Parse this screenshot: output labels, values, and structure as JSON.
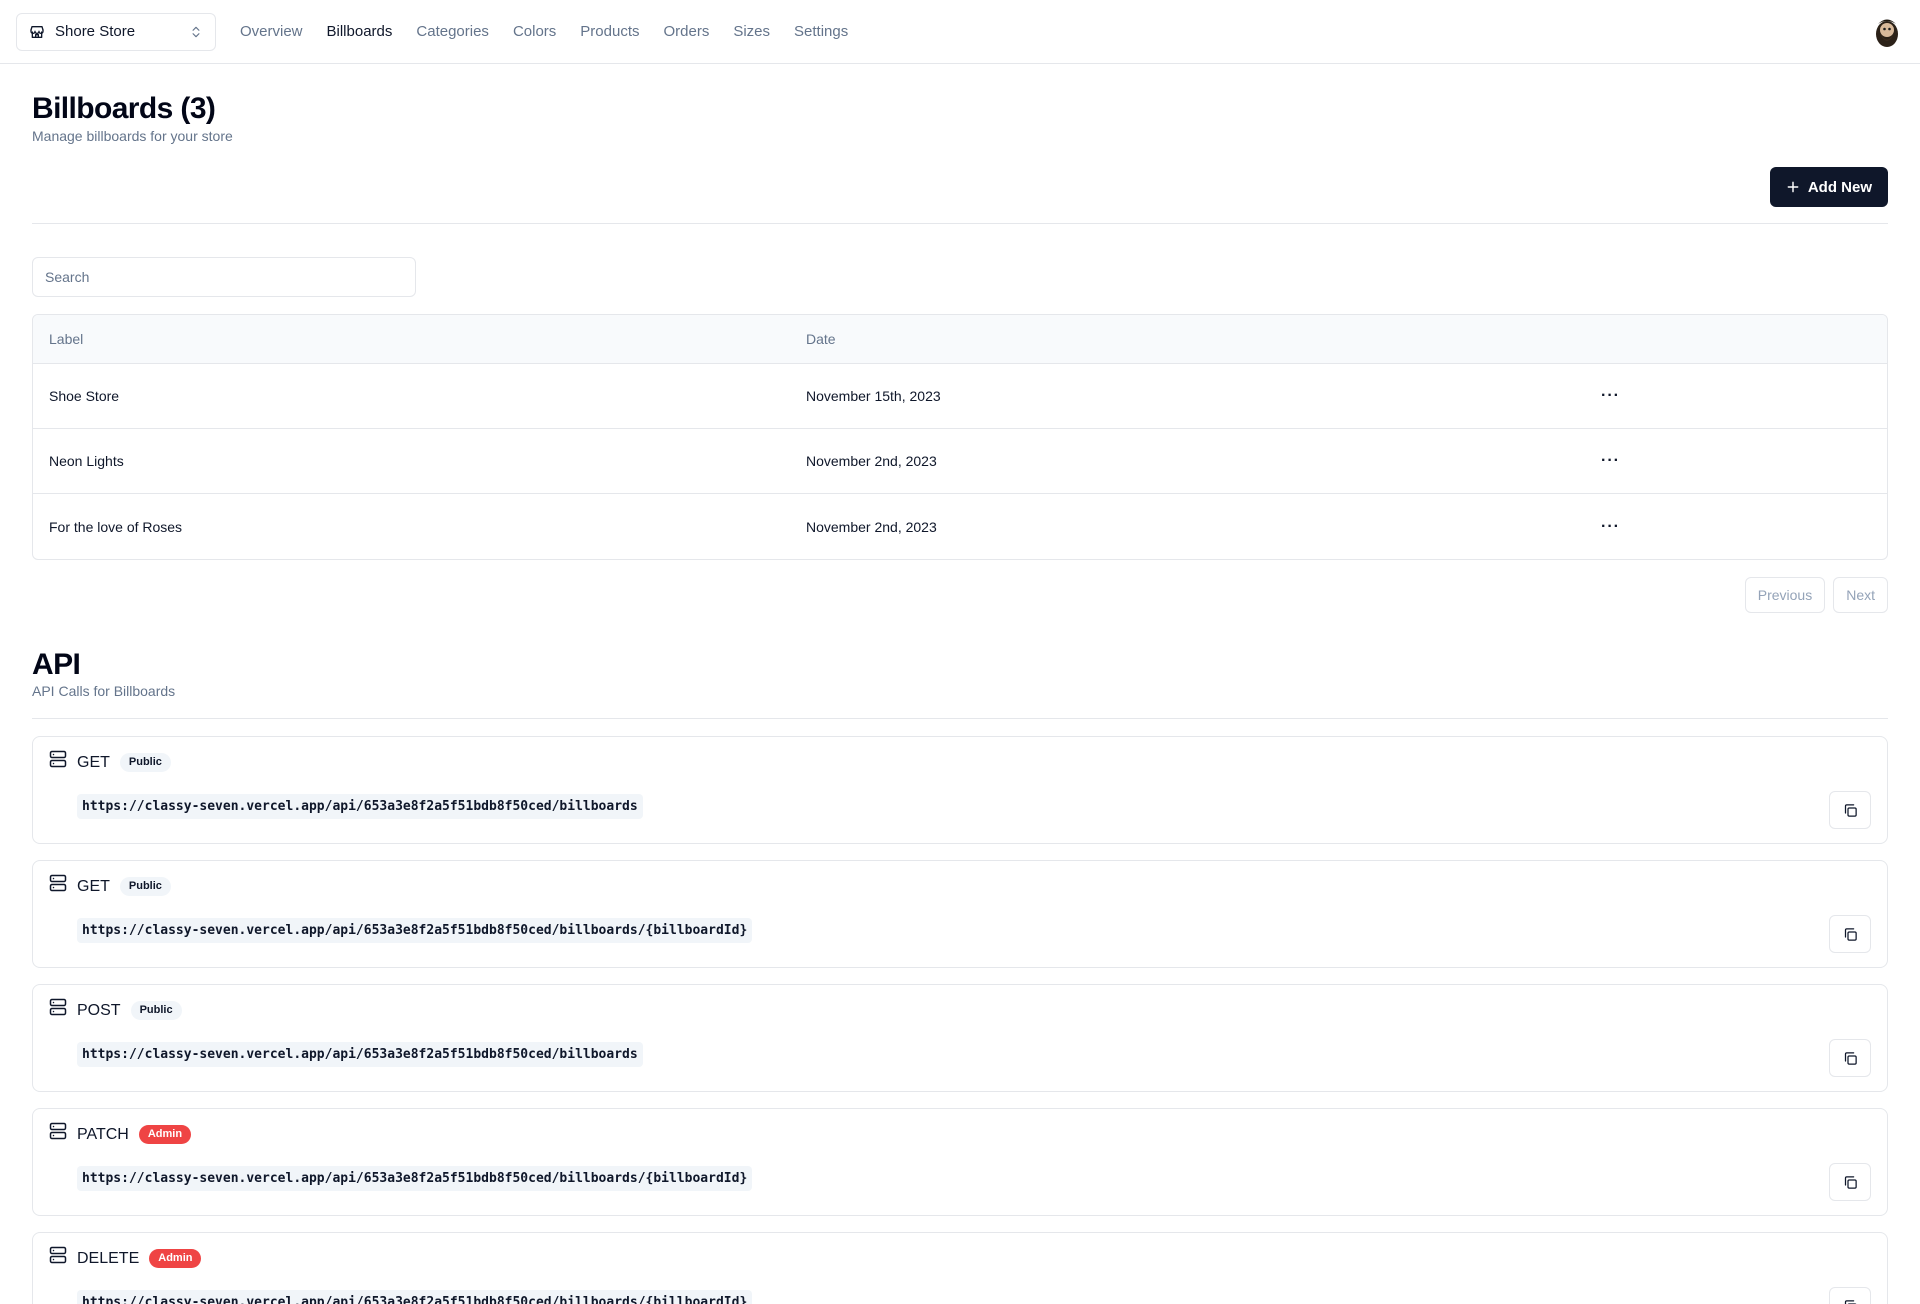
{
  "topbar": {
    "store_name": "Shore Store",
    "nav": [
      "Overview",
      "Billboards",
      "Categories",
      "Colors",
      "Products",
      "Orders",
      "Sizes",
      "Settings"
    ],
    "active_nav": "Billboards"
  },
  "header": {
    "title": "Billboards (3)",
    "subtitle": "Manage billboards for your store",
    "add_label": "Add New"
  },
  "search": {
    "placeholder": "Search",
    "value": ""
  },
  "table": {
    "columns": [
      "Label",
      "Date"
    ],
    "rows": [
      {
        "label": "Shoe Store",
        "date": "November 15th, 2023"
      },
      {
        "label": "Neon Lights",
        "date": "November 2nd, 2023"
      },
      {
        "label": "For the love of Roses",
        "date": "November 2nd, 2023"
      }
    ]
  },
  "pager": {
    "prev": "Previous",
    "next": "Next"
  },
  "api": {
    "title": "API",
    "subtitle": "API Calls for Billboards",
    "endpoints": [
      {
        "method": "GET",
        "badge": "Public",
        "badge_variant": "public",
        "url": "https://classy-seven.vercel.app/api/653a3e8f2a5f51bdb8f50ced/billboards"
      },
      {
        "method": "GET",
        "badge": "Public",
        "badge_variant": "public",
        "url": "https://classy-seven.vercel.app/api/653a3e8f2a5f51bdb8f50ced/billboards/{billboardId}"
      },
      {
        "method": "POST",
        "badge": "Public",
        "badge_variant": "public",
        "url": "https://classy-seven.vercel.app/api/653a3e8f2a5f51bdb8f50ced/billboards"
      },
      {
        "method": "PATCH",
        "badge": "Admin",
        "badge_variant": "admin",
        "url": "https://classy-seven.vercel.app/api/653a3e8f2a5f51bdb8f50ced/billboards/{billboardId}"
      },
      {
        "method": "DELETE",
        "badge": "Admin",
        "badge_variant": "admin",
        "url": "https://classy-seven.vercel.app/api/653a3e8f2a5f51bdb8f50ced/billboards/{billboardId}"
      }
    ]
  },
  "icons": {
    "store": "store-icon",
    "switcher": "chevrons-up-down-icon",
    "plus": "plus-icon",
    "row_actions": "more-horizontal-icon",
    "endpoint": "server-icon",
    "copy": "copy-icon"
  },
  "colors": {
    "primary": "#0f172a",
    "muted_text": "#64748b",
    "border": "#e5e7eb",
    "admin_badge": "#ef4444",
    "public_badge": "#f1f5f9"
  }
}
